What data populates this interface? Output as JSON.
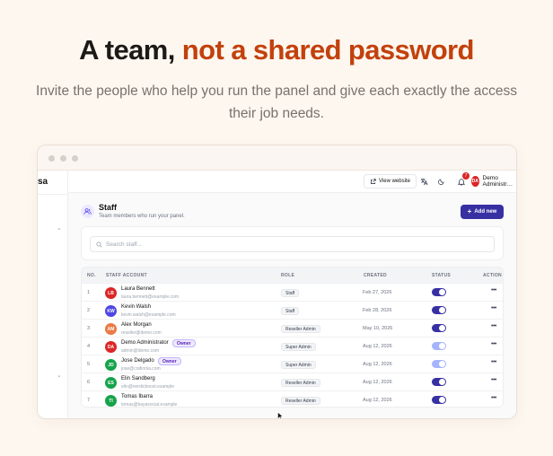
{
  "hero": {
    "title_lead": "A team,",
    "title_accent": "not a shared password",
    "subtitle": "Invite the people who help you run the panel and give each exactly the access their job needs."
  },
  "colors": {
    "accent": "#c2410c",
    "primary": "#3730a3",
    "background": "#fdf7f0"
  },
  "app": {
    "brand_fragment": "sa",
    "topbar": {
      "view_website": "View website",
      "notification_count": "7",
      "user_initials": "DA",
      "user_name": "Demo Administr…"
    },
    "page": {
      "title": "Staff",
      "subtitle": "Team members who run your panel.",
      "add_button": "Add new"
    },
    "search": {
      "placeholder": "Search staff..."
    },
    "table": {
      "headers": {
        "no": "NO.",
        "account": "STAFF ACCOUNT",
        "role": "ROLE",
        "created": "CREATED",
        "status": "STATUS",
        "action": "ACTION"
      },
      "rows": [
        {
          "no": "1",
          "initials": "LB",
          "avatar_color": "#dc2626",
          "name": "Laura Bennett",
          "email": "laura.bennett@example.com",
          "badge": "",
          "role": "Staff",
          "created": "Feb 27, 2026",
          "status": "active"
        },
        {
          "no": "2",
          "initials": "KW",
          "avatar_color": "#4f46e5",
          "name": "Kevin Walsh",
          "email": "kevin.walsh@example.com",
          "badge": "",
          "role": "Staff",
          "created": "Feb 28, 2026",
          "status": "active"
        },
        {
          "no": "3",
          "initials": "AM",
          "avatar_color": "#ea7a45",
          "name": "Alex Morgan",
          "email": "reseller@demo.com",
          "badge": "",
          "role": "Reseller Admin",
          "created": "May 10, 2026",
          "status": "active"
        },
        {
          "no": "4",
          "initials": "DA",
          "avatar_color": "#dc2626",
          "name": "Demo Administrator",
          "email": "admin@demo.com",
          "badge": "Owner",
          "role": "Super Admin",
          "created": "Aug 12, 2026",
          "status": "locked"
        },
        {
          "no": "5",
          "initials": "JD",
          "avatar_color": "#16a34a",
          "name": "Jose Delgado",
          "email": "jose@codinnia.com",
          "badge": "Owner",
          "role": "Super Admin",
          "created": "Aug 12, 2026",
          "status": "locked"
        },
        {
          "no": "6",
          "initials": "ES",
          "avatar_color": "#16a34a",
          "name": "Elin Sandberg",
          "email": "elin@nordicboost.example",
          "badge": "",
          "role": "Reseller Admin",
          "created": "Aug 12, 2026",
          "status": "active"
        },
        {
          "no": "7",
          "initials": "TI",
          "avatar_color": "#16a34a",
          "name": "Tomas Ibarra",
          "email": "tomas@kayasocial.example",
          "badge": "",
          "role": "Reseller Admin",
          "created": "Aug 12, 2026",
          "status": "active"
        }
      ]
    }
  }
}
